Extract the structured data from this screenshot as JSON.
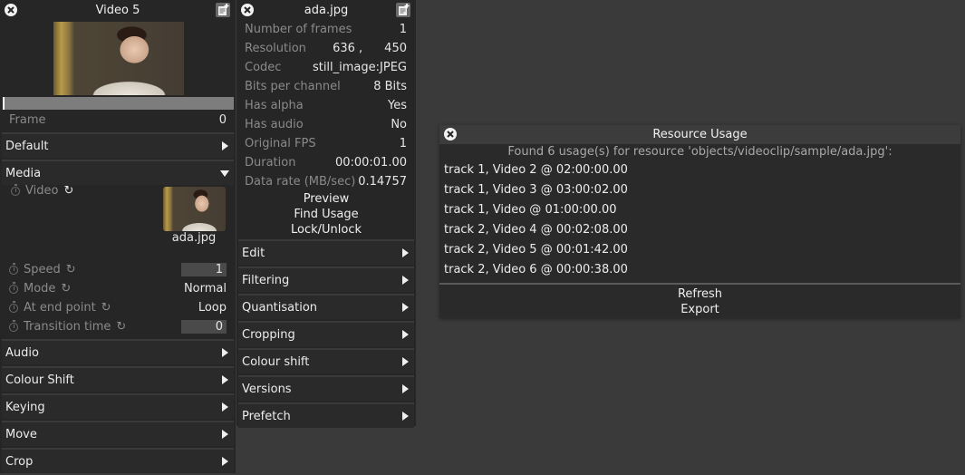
{
  "left_panel": {
    "title": "Video 5",
    "frame_label": "Frame",
    "frame_value": "0",
    "sections_top": [
      {
        "label": "Default",
        "expanded": false
      },
      {
        "label": "Media",
        "expanded": true
      }
    ],
    "media": {
      "video_label": "Video",
      "thumb_caption": "ada.jpg",
      "params": [
        {
          "label": "Speed",
          "value": "1",
          "boxed": true
        },
        {
          "label": "Mode",
          "value": "Normal",
          "boxed": false
        },
        {
          "label": "At end point",
          "value": "Loop",
          "boxed": false
        },
        {
          "label": "Transition time",
          "value": "0",
          "boxed": true
        }
      ]
    },
    "sections_bottom": [
      {
        "label": "Audio"
      },
      {
        "label": "Colour Shift"
      },
      {
        "label": "Keying"
      },
      {
        "label": "Move"
      },
      {
        "label": "Crop"
      }
    ],
    "icons": {
      "close": "close-circle-icon",
      "notes": "add-note-icon",
      "keyframe": "stopwatch-icon",
      "reset": "reset-icon"
    }
  },
  "middle_panel": {
    "title": "ada.jpg",
    "props": [
      {
        "label": "Number of frames",
        "value": "1"
      },
      {
        "label": "Resolution",
        "value": "636 ,",
        "value2": "450"
      },
      {
        "label": "Codec",
        "value": "still_image:JPEG"
      },
      {
        "label": "Bits per channel",
        "value": "8 Bits"
      },
      {
        "label": "Has alpha",
        "value": "Yes"
      },
      {
        "label": "Has audio",
        "value": "No"
      },
      {
        "label": "Original FPS",
        "value": "1"
      },
      {
        "label": "Duration",
        "value": "00:00:01.00"
      },
      {
        "label": "Data rate (MB/sec)",
        "value": "0.14757"
      }
    ],
    "actions": [
      "Preview",
      "Find Usage",
      "Lock/Unlock"
    ],
    "sections": [
      "Edit",
      "Filtering",
      "Quantisation",
      "Cropping",
      "Colour shift",
      "Versions",
      "Prefetch"
    ]
  },
  "resource_usage": {
    "title": "Resource Usage",
    "summary": "Found 6 usage(s) for resource 'objects/videoclip/sample/ada.jpg':",
    "items": [
      "track 1, Video 2 @ 02:00:00.00",
      "track 1, Video 3 @ 03:00:02.00",
      "track 1, Video @ 01:00:00.00",
      "track 2, Video 4 @ 00:02:08.00",
      "track 2, Video 5 @ 00:01:42.00",
      "track 2, Video 6 @ 00:00:38.00"
    ],
    "refresh_label": "Refresh",
    "export_label": "Export"
  }
}
